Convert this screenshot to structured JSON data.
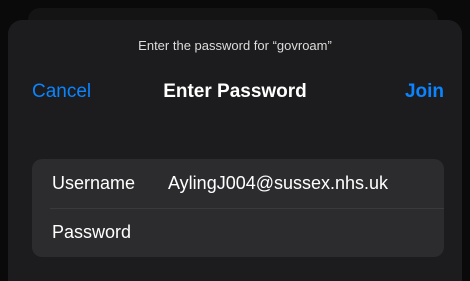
{
  "dialog": {
    "prompt": "Enter the password for “govroam”"
  },
  "nav": {
    "cancel_label": "Cancel",
    "title": "Enter Password",
    "join_label": "Join"
  },
  "form": {
    "username": {
      "label": "Username",
      "value": "AylingJ004@sussex.nhs.uk"
    },
    "password": {
      "label": "Password",
      "value": ""
    }
  },
  "colors": {
    "accent": "#0a84ff",
    "sheet_background": "#1c1c1e",
    "field_background": "#2c2c2e"
  }
}
